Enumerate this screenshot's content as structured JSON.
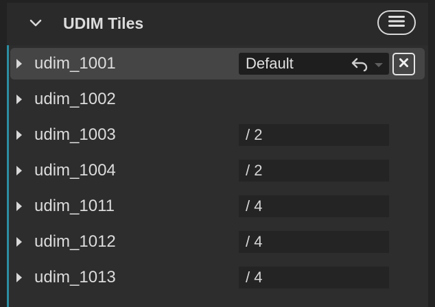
{
  "header": {
    "title": "UDIM Tiles",
    "collapse_icon": "chevron-down-icon",
    "menu_icon": "hamburger-menu-icon"
  },
  "rows": [
    {
      "label": "udim_1001",
      "dropdown_value": "Default",
      "revert_icon": "revert-arrow-icon",
      "caret_icon": "caret-down-icon",
      "clear_icon": "close-box-icon"
    },
    {
      "label": "udim_1002"
    },
    {
      "label": "udim_1003",
      "value": "/ 2"
    },
    {
      "label": "udim_1004",
      "value": "/ 2"
    },
    {
      "label": "udim_1011",
      "value": "/ 4"
    },
    {
      "label": "udim_1012",
      "value": "/ 4"
    },
    {
      "label": "udim_1013",
      "value": "/ 4"
    }
  ],
  "colors": {
    "accent": "#2b8fa3",
    "background": "#2d2d2d",
    "selected_row": "#454545",
    "field": "#242424",
    "text": "#dcdcdc"
  }
}
